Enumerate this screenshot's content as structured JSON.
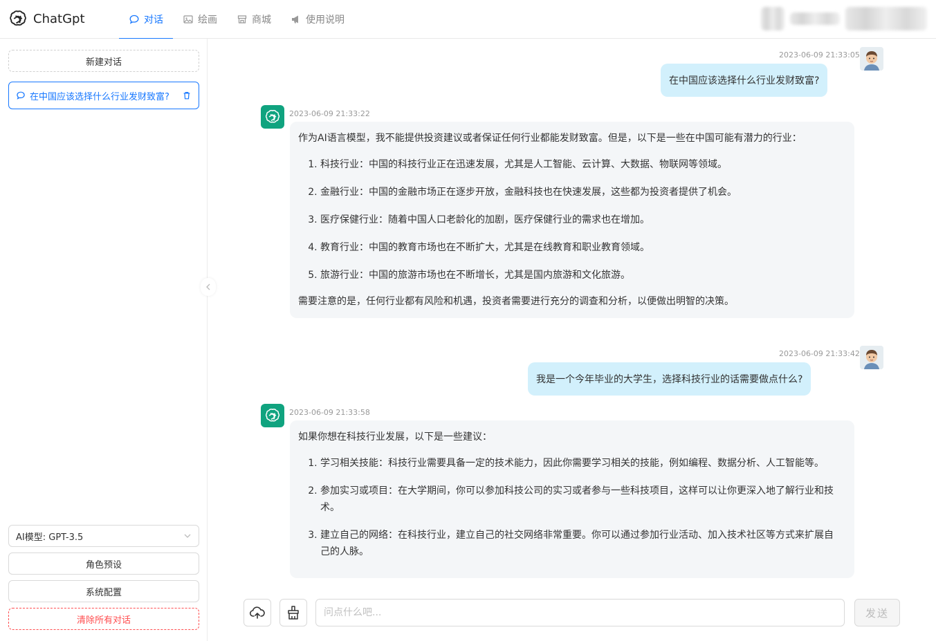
{
  "header": {
    "brand": "ChatGpt",
    "tabs": [
      {
        "label": "对话",
        "icon": "chat-icon",
        "active": true
      },
      {
        "label": "绘画",
        "icon": "image-icon",
        "active": false
      },
      {
        "label": "商城",
        "icon": "store-icon",
        "active": false
      },
      {
        "label": "使用说明",
        "icon": "megaphone-icon",
        "active": false
      }
    ]
  },
  "sidebar": {
    "new_chat_label": "新建对话",
    "conversations": [
      {
        "title": "在中国应该选择什么行业发财致富?"
      }
    ],
    "model_select": "AI模型: GPT-3.5",
    "role_preset_label": "角色预设",
    "system_config_label": "系统配置",
    "clear_all_label": "清除所有对话"
  },
  "messages": [
    {
      "role": "user",
      "time": "2023-06-09 21:33:05",
      "text": "在中国应该选择什么行业发财致富?"
    },
    {
      "role": "assistant",
      "time": "2023-06-09 21:33:22",
      "intro": "作为AI语言模型，我不能提供投资建议或者保证任何行业都能发财致富。但是，以下是一些在中国可能有潜力的行业：",
      "items": [
        "科技行业：中国的科技行业正在迅速发展，尤其是人工智能、云计算、大数据、物联网等领域。",
        "金融行业：中国的金融市场正在逐步开放，金融科技也在快速发展，这些都为投资者提供了机会。",
        "医疗保健行业：随着中国人口老龄化的加剧，医疗保健行业的需求也在增加。",
        "教育行业：中国的教育市场也在不断扩大，尤其是在线教育和职业教育领域。",
        "旅游行业：中国的旅游市场也在不断增长，尤其是国内旅游和文化旅游。"
      ],
      "outro": "需要注意的是，任何行业都有风险和机遇，投资者需要进行充分的调查和分析，以便做出明智的决策。"
    },
    {
      "role": "user",
      "time": "2023-06-09 21:33:42",
      "text": "我是一个今年毕业的大学生，选择科技行业的话需要做点什么?"
    },
    {
      "role": "assistant",
      "time": "2023-06-09 21:33:58",
      "intro": "如果你想在科技行业发展，以下是一些建议：",
      "items": [
        "学习相关技能：科技行业需要具备一定的技术能力，因此你需要学习相关的技能，例如编程、数据分析、人工智能等。",
        "参加实习或项目：在大学期间，你可以参加科技公司的实习或者参与一些科技项目，这样可以让你更深入地了解行业和技术。",
        "建立自己的网络：在科技行业，建立自己的社交网络非常重要。你可以通过参加行业活动、加入技术社区等方式来扩展自己的人脉。"
      ]
    }
  ],
  "input": {
    "placeholder": "问点什么吧...",
    "send_label": "发送"
  },
  "colors": {
    "accent": "#1677ff",
    "user_bubble": "#d2f0fc",
    "bot_bubble": "#f4f6f8",
    "bot_avatar": "#10a37f",
    "danger": "#ff4d4f"
  }
}
